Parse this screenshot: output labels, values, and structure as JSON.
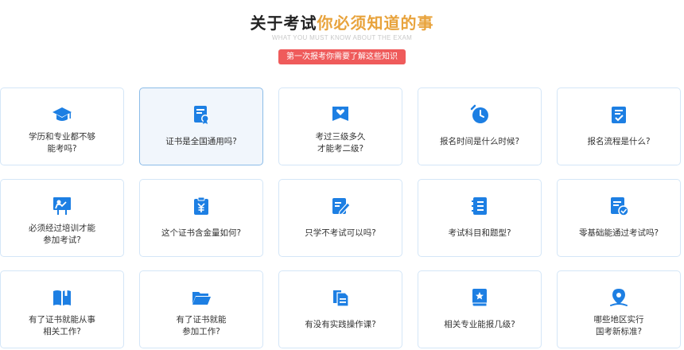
{
  "header": {
    "title_dark": "关于考试",
    "title_accent": "你必须知道的事",
    "subtitle": "WHAT YOU MUST KNOW ABOUT THE EXAM",
    "banner": "第一次报考你需要了解这些知识"
  },
  "colors": {
    "icon_blue": "#1d7fe3",
    "accent": "#e8a33c",
    "banner": "#ef5b5b",
    "card_border": "#d4e6f7"
  },
  "cards": [
    {
      "label": "学历和专业都不够\n能考吗?",
      "icon": "graduation-cap-icon"
    },
    {
      "label": "证书是全国通用吗?",
      "icon": "certificate-icon"
    },
    {
      "label": "考过三级多久\n才能考二级?",
      "icon": "heart-bookmark-icon"
    },
    {
      "label": "报名时间是什么时候?",
      "icon": "clock-icon"
    },
    {
      "label": "报名流程是什么?",
      "icon": "checklist-icon"
    },
    {
      "label": "必须经过培训才能\n参加考试?",
      "icon": "training-board-icon"
    },
    {
      "label": "这个证书含金量如何?",
      "icon": "yuan-clipboard-icon"
    },
    {
      "label": "只学不考试可以吗?",
      "icon": "edit-document-icon"
    },
    {
      "label": "考试科目和题型?",
      "icon": "notebook-icon"
    },
    {
      "label": "零基础能通过考试吗?",
      "icon": "document-check-icon"
    },
    {
      "label": "有了证书就能从事\n相关工作?",
      "icon": "open-book-icon"
    },
    {
      "label": "有了证书就能\n参加工作?",
      "icon": "folder-icon"
    },
    {
      "label": "有没有实践操作课?",
      "icon": "documents-icon"
    },
    {
      "label": "相关专业能报几级?",
      "icon": "star-book-icon"
    },
    {
      "label": "哪些地区实行\n国考新标准?",
      "icon": "location-pin-icon"
    }
  ]
}
